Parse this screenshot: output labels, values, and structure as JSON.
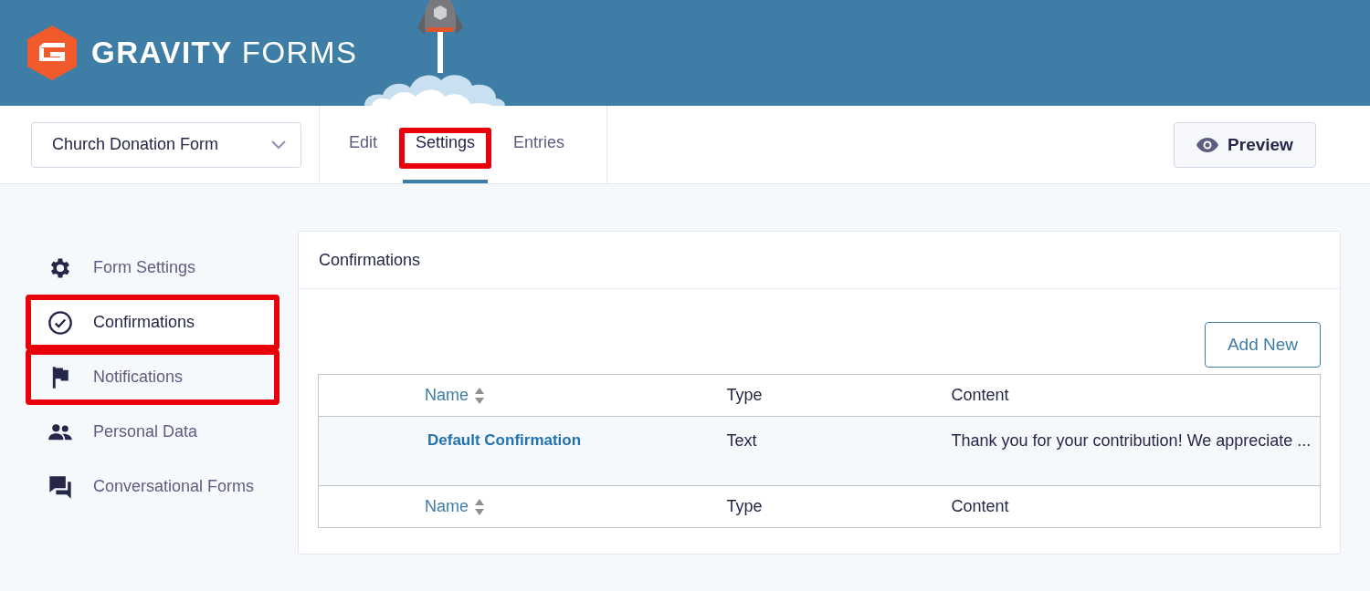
{
  "header": {
    "logo_bold": "GRAVITY",
    "logo_light": "FORMS"
  },
  "form_selector": {
    "value": "Church Donation Form"
  },
  "tabs": [
    {
      "label": "Edit",
      "selected": false,
      "highlighted": false
    },
    {
      "label": "Settings",
      "selected": true,
      "highlighted": true
    },
    {
      "label": "Entries",
      "selected": false,
      "highlighted": false
    }
  ],
  "preview_button": "Preview",
  "sidebar": {
    "items": [
      {
        "label": "Form Settings",
        "kind": "gear",
        "selected": false,
        "highlighted": false
      },
      {
        "label": "Confirmations",
        "kind": "check-circle",
        "selected": true,
        "highlighted": true
      },
      {
        "label": "Notifications",
        "kind": "flag",
        "selected": false,
        "highlighted": true
      },
      {
        "label": "Personal Data",
        "kind": "people",
        "selected": false,
        "highlighted": false
      },
      {
        "label": "Conversational Forms",
        "kind": "chat",
        "selected": false,
        "highlighted": false
      }
    ]
  },
  "panel": {
    "title": "Confirmations",
    "add_button": "Add New",
    "table": {
      "columns": [
        {
          "label": "Name",
          "sortable": true
        },
        {
          "label": "Type",
          "sortable": false
        },
        {
          "label": "Content",
          "sortable": false
        }
      ],
      "rows": [
        {
          "name": "Default Confirmation",
          "type": "Text",
          "content": "Thank you for your contribution! We appreciate ..."
        }
      ],
      "footer_columns": [
        {
          "label": "Name",
          "sortable": true
        },
        {
          "label": "Type",
          "sortable": false
        },
        {
          "label": "Content",
          "sortable": false
        }
      ]
    }
  }
}
